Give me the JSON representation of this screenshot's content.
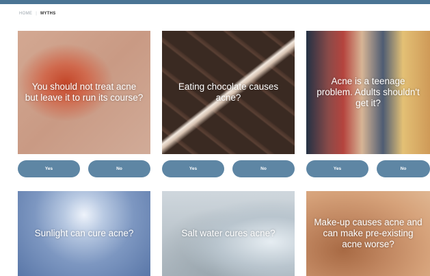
{
  "breadcrumb": {
    "home": "HOME",
    "current": "MYTHS"
  },
  "cards": [
    {
      "question": "You should not treat acne but leave it to run its course?",
      "image": "skin-redness-photo",
      "yes_label": "Yes",
      "no_label": "No"
    },
    {
      "question": "Eating chocolate causes acne?",
      "image": "chocolate-bar-photo",
      "yes_label": "Yes",
      "no_label": "No"
    },
    {
      "question": "Acne is a teenage problem. Adults shouldn't get it?",
      "image": "teenagers-hiking-photo",
      "yes_label": "Yes",
      "no_label": "No"
    },
    {
      "question": "Sunlight can cure acne?",
      "image": "sunny-sky-photo"
    },
    {
      "question": "Salt water cures acne?",
      "image": "salt-water-glass-photo"
    },
    {
      "question": "Make-up causes acne and can make pre-existing acne worse?",
      "image": "makeup-foundation-photo"
    }
  ],
  "colors": {
    "top_bar": "#4a7494",
    "button": "#5e86a4",
    "breadcrumb_current": "#2b2b2b"
  }
}
